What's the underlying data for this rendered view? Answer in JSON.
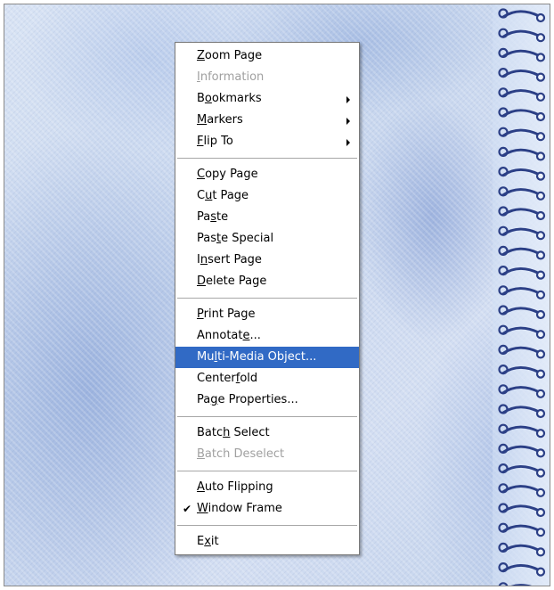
{
  "window": {
    "background": "#c7d6ee",
    "accent": "#316ac5"
  },
  "binding": {
    "icon": "spiral-binding-ring-icon",
    "ring_color": "#2b3f86"
  },
  "context_menu": {
    "groups": [
      [
        {
          "label": "Zoom Page",
          "mnemonic_index": 0,
          "disabled": false,
          "submenu": false
        },
        {
          "label": "Information",
          "mnemonic_index": 0,
          "disabled": true,
          "submenu": false
        },
        {
          "label": "Bookmarks",
          "mnemonic_index": 1,
          "disabled": false,
          "submenu": true
        },
        {
          "label": "Markers",
          "mnemonic_index": 0,
          "disabled": false,
          "submenu": true
        },
        {
          "label": "Flip To",
          "mnemonic_index": 0,
          "disabled": false,
          "submenu": true
        }
      ],
      [
        {
          "label": "Copy Page",
          "mnemonic_index": 0,
          "disabled": false,
          "submenu": false
        },
        {
          "label": "Cut Page",
          "mnemonic_index": 1,
          "disabled": false,
          "submenu": false
        },
        {
          "label": "Paste",
          "mnemonic_index": 2,
          "disabled": false,
          "submenu": false
        },
        {
          "label": "Paste Special",
          "mnemonic_index": 3,
          "disabled": false,
          "submenu": false
        },
        {
          "label": "Insert Page",
          "mnemonic_index": 1,
          "disabled": false,
          "submenu": false
        },
        {
          "label": "Delete Page",
          "mnemonic_index": 0,
          "disabled": false,
          "submenu": false
        }
      ],
      [
        {
          "label": "Print Page",
          "mnemonic_index": 0,
          "disabled": false,
          "submenu": false
        },
        {
          "label": "Annotate...",
          "mnemonic_index": 7,
          "disabled": false,
          "submenu": false
        },
        {
          "label": "Multi-Media Object...",
          "mnemonic_index": 2,
          "disabled": false,
          "submenu": false,
          "selected": true
        },
        {
          "label": "Centerfold",
          "mnemonic_index": 6,
          "disabled": false,
          "submenu": false
        },
        {
          "label": "Page Properties...",
          "mnemonic_index": 2,
          "disabled": false,
          "submenu": false
        }
      ],
      [
        {
          "label": "Batch Select",
          "mnemonic_index": 4,
          "disabled": false,
          "submenu": false
        },
        {
          "label": "Batch Deselect",
          "mnemonic_index": 0,
          "disabled": true,
          "submenu": false
        }
      ],
      [
        {
          "label": "Auto Flipping",
          "mnemonic_index": 0,
          "disabled": false,
          "submenu": false
        },
        {
          "label": "Window Frame",
          "mnemonic_index": 0,
          "disabled": false,
          "submenu": false,
          "checked": true
        }
      ],
      [
        {
          "label": "Exit",
          "mnemonic_index": 1,
          "disabled": false,
          "submenu": false
        }
      ]
    ],
    "check_glyph": "✔"
  }
}
